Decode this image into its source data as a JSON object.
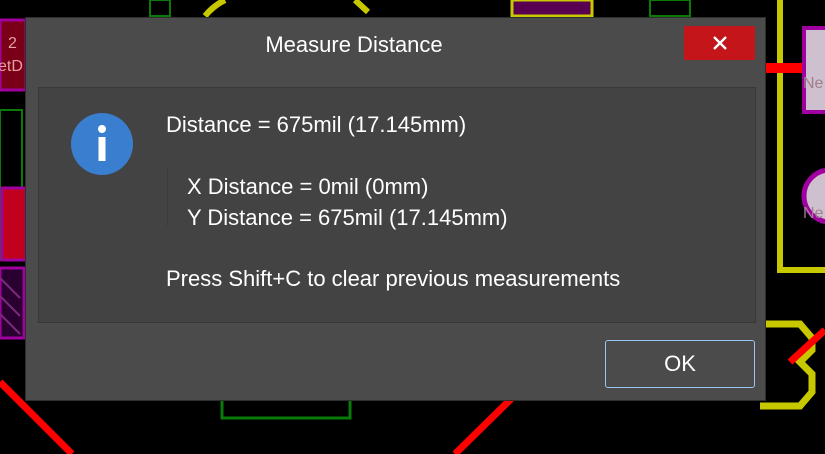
{
  "background": {
    "labels": {
      "left_top_digit": "2",
      "left_net": "etD",
      "right_top": "Ne",
      "right_circle": "Ne"
    },
    "colors": {
      "trace_red": "#ff0000",
      "outline_yellow": "#c8c800",
      "outline_green": "#0a7a0a",
      "pad_magenta": "#a000a0",
      "pad_red": "#c0001c"
    }
  },
  "dialog": {
    "title": "Measure Distance",
    "close_label": "×",
    "icon": "info-icon",
    "icon_color": "#3a7fcf",
    "distance_line": "Distance = 675mil (17.145mm)",
    "x_distance_line": "X Distance = 0mil (0mm)",
    "y_distance_line": "Y Distance = 675mil (17.145mm)",
    "hint_line": "Press Shift+C to clear previous measurements",
    "ok_label": "OK"
  }
}
